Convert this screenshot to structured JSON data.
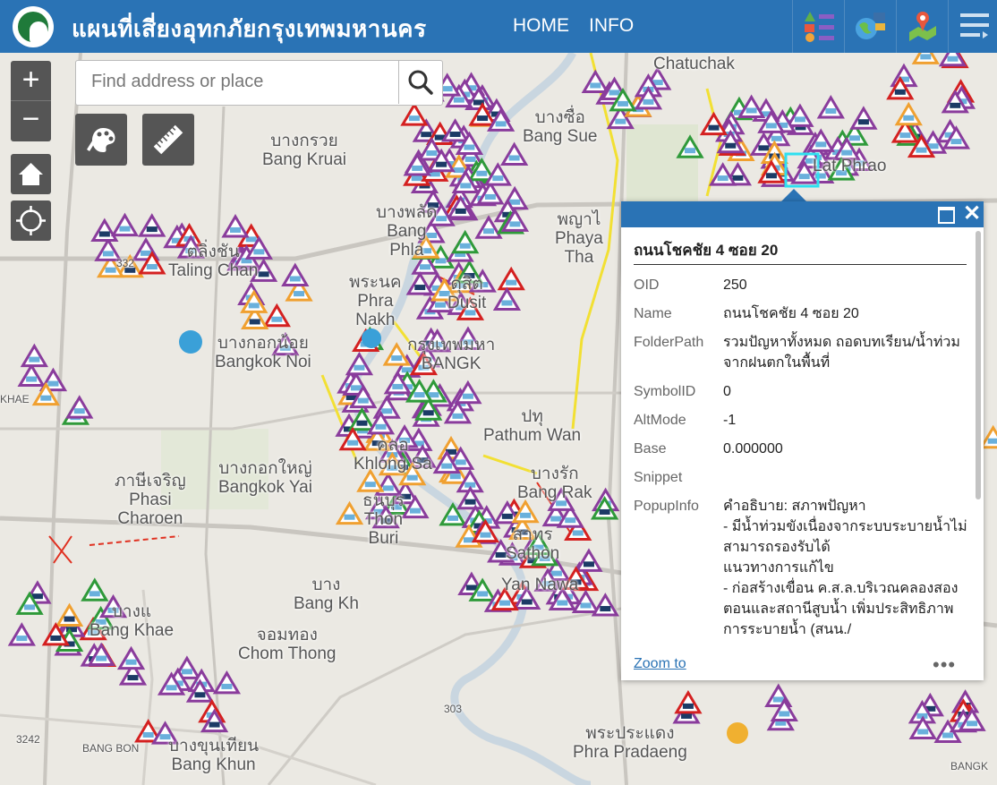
{
  "header": {
    "title": "แผนที่เสี่ยงอุทกภัยกรุงเทพมหานคร",
    "nav": {
      "home": "HOME",
      "info": "INFO"
    },
    "accent_color": "#2a73b5",
    "icons": [
      "legend-icon",
      "basemap-gallery-icon",
      "layer-list-icon",
      "menu-icon"
    ]
  },
  "search": {
    "placeholder": "Find address or place",
    "value": ""
  },
  "controls": {
    "zoom_in": "+",
    "zoom_out": "−",
    "icons": [
      "home-icon",
      "locate-icon",
      "draw-palette-icon",
      "measure-ruler-icon"
    ]
  },
  "map_labels": [
    {
      "id": "chatuchak",
      "lines": [
        "Chatuchak"
      ]
    },
    {
      "id": "bang-sue",
      "lines": [
        "บางซื่อ",
        "Bang Sue"
      ]
    },
    {
      "id": "bang-kruai",
      "lines": [
        "บางกรวย",
        "Bang Kruai"
      ]
    },
    {
      "id": "lat-phrao",
      "lines": [
        "Lat Phrao"
      ]
    },
    {
      "id": "taling-chan",
      "lines": [
        "ตลิ่งชัน",
        "Taling Chan"
      ]
    },
    {
      "id": "bang-phlat",
      "lines": [
        "บางพลัด",
        "Bang",
        "Phla"
      ]
    },
    {
      "id": "phaya-thai",
      "lines": [
        "พญาไ",
        "Phaya",
        "Tha"
      ]
    },
    {
      "id": "dusit",
      "lines": [
        "ดุสิต",
        "Dusit"
      ]
    },
    {
      "id": "phra-nakhon",
      "lines": [
        "พระนค",
        "Phra",
        "Nakh"
      ]
    },
    {
      "id": "bangkok-noi",
      "lines": [
        "บางกอกน้อย",
        "Bangkok Noi"
      ]
    },
    {
      "id": "bangkok",
      "lines": [
        "กรุงเทพมหา",
        "BANGK"
      ]
    },
    {
      "id": "pathum-wan",
      "lines": [
        "ปทุ",
        "Pathum Wan"
      ]
    },
    {
      "id": "khlong-san",
      "lines": [
        "คลอ",
        "Khlong Sa"
      ]
    },
    {
      "id": "bangkok-yai",
      "lines": [
        "บางกอกใหญ่",
        "Bangkok Yai"
      ]
    },
    {
      "id": "phasi-charoen",
      "lines": [
        "ภาษีเจริญ",
        "Phasi",
        "Charoen"
      ]
    },
    {
      "id": "thon-buri",
      "lines": [
        "ธนบุร",
        "Thon",
        "Buri"
      ]
    },
    {
      "id": "bang-rak",
      "lines": [
        "บางรัก",
        "Bang Rak"
      ]
    },
    {
      "id": "sathon",
      "lines": [
        "สาทร",
        "Sathon"
      ]
    },
    {
      "id": "yan-nawa",
      "lines": [
        "Yan Nawa"
      ]
    },
    {
      "id": "bang-khae",
      "lines": [
        "บางแ",
        "Bang Khae"
      ]
    },
    {
      "id": "bang-kho-laem",
      "lines": [
        "บาง",
        "Bang Kh"
      ]
    },
    {
      "id": "chom-thong",
      "lines": [
        "จอมทอง",
        "Chom Thong"
      ]
    },
    {
      "id": "bang-khun-thian",
      "lines": [
        "บางขุนเทียน",
        "Bang Khun"
      ]
    },
    {
      "id": "phra-pradaeng",
      "lines": [
        "พระประแดง",
        "Phra Pradaeng"
      ]
    },
    {
      "id": "road-332",
      "lines": [
        "332"
      ]
    },
    {
      "id": "road-303",
      "lines": [
        "303"
      ]
    },
    {
      "id": "road-3242",
      "lines": [
        "3242"
      ]
    },
    {
      "id": "road-khae",
      "lines": [
        "KHAE"
      ]
    },
    {
      "id": "road-bang-bon",
      "lines": [
        "BANG BON"
      ]
    },
    {
      "id": "road-bangk",
      "lines": [
        "BANGK"
      ]
    }
  ],
  "popup": {
    "title": "ถนนโชคชัย 4 ซอย 20",
    "fields": [
      {
        "key": "OID",
        "value": "250"
      },
      {
        "key": "Name",
        "value": "ถนนโชคชัย 4 ซอย 20"
      },
      {
        "key": "FolderPath",
        "value": "รวมปัญหาทั้งหมด ถอดบทเรียน/น้ำท่วมจากฝนตกในพื้นที่"
      },
      {
        "key": "SymbolID",
        "value": "0"
      },
      {
        "key": "AltMode",
        "value": "-1"
      },
      {
        "key": "Base",
        "value": "0.000000"
      },
      {
        "key": "Snippet",
        "value": ""
      },
      {
        "key": "PopupInfo",
        "value": "คำอธิบาย: สภาพปัญหา\n- มีน้ำท่วมขังเนื่องจากระบบระบายน้ำไม่สามารถรองรับได้\nแนวทางการแก้ไข\n- ก่อสร้างเขื่อน ค.ส.ล.บริเวณคลองสองตอนและสถานีสูบน้ำ เพิ่มประสิทธิภาพการระบายน้ำ (สนน./"
      }
    ],
    "zoom_to": "Zoom to",
    "more": "•••"
  },
  "colors": {
    "marker_purple": "#8a3c9c",
    "marker_orange": "#f0a030",
    "marker_red": "#d42020",
    "marker_green": "#2f9a3a",
    "road_yellow": "#f2e033"
  }
}
